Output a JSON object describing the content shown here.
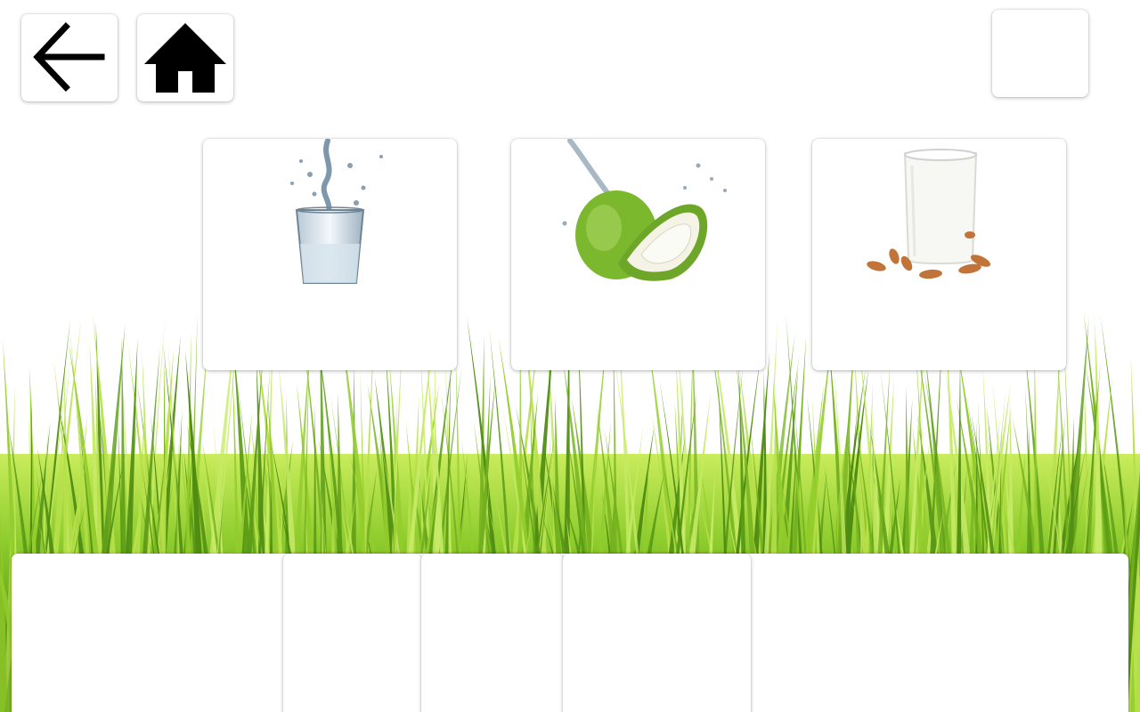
{
  "toolbar": {
    "back_icon": "arrow-left-icon",
    "home_icon": "home-icon"
  },
  "drinks": [
    {
      "icon": "water-glass-icon",
      "label": ""
    },
    {
      "icon": "coconut-water-icon",
      "label": ""
    },
    {
      "icon": "almond-milk-icon",
      "label": ""
    }
  ],
  "colors": {
    "background": "#ffffff",
    "grass_light": "#a6d83a",
    "grass_dark": "#3f7d12",
    "card": "#ffffff",
    "icon": "#000000"
  }
}
